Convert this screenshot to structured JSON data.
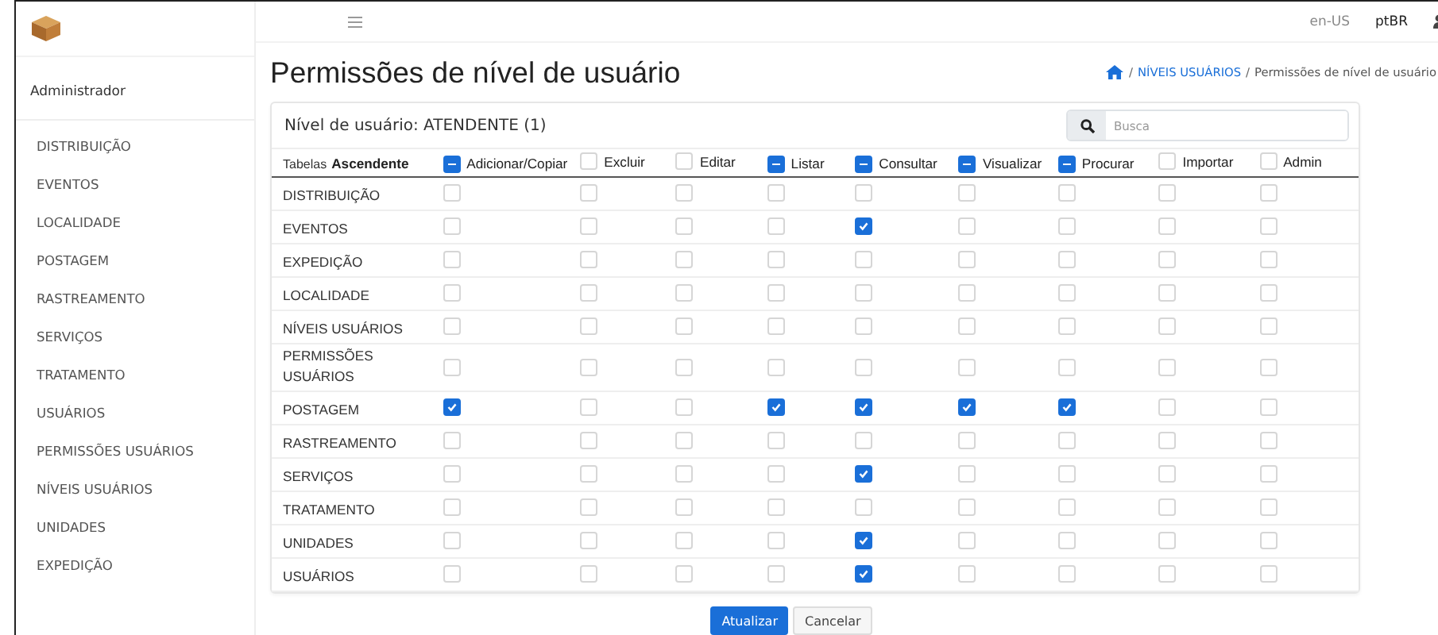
{
  "topbar": {
    "languages": [
      {
        "label": "en-US",
        "selected": false
      },
      {
        "label": "ptBR",
        "selected": true
      }
    ]
  },
  "sidebar": {
    "user": "Administrador",
    "items": [
      {
        "label": "DISTRIBUIÇÃO"
      },
      {
        "label": "EVENTOS"
      },
      {
        "label": "LOCALIDADE"
      },
      {
        "label": "POSTAGEM"
      },
      {
        "label": "RASTREAMENTO"
      },
      {
        "label": "SERVIÇOS"
      },
      {
        "label": "TRATAMENTO"
      },
      {
        "label": "USUÁRIOS"
      },
      {
        "label": "PERMISSÕES USUÁRIOS"
      },
      {
        "label": "NÍVEIS USUÁRIOS"
      },
      {
        "label": "UNIDADES"
      },
      {
        "label": "EXPEDIÇÃO"
      }
    ]
  },
  "page": {
    "title": "Permissões de nível de usuário",
    "breadcrumb": [
      {
        "separator": "/",
        "label": "NÍVEIS USUÁRIOS",
        "kind": "link"
      },
      {
        "separator": "/",
        "label": "Permissões de nível de usuário",
        "kind": "current"
      }
    ]
  },
  "card": {
    "level_label": "Nível de usuário: ATENDENTE (1)",
    "search": {
      "placeholder": "Busca"
    },
    "table": {
      "tables_label": "Tabelas",
      "sort_label": "Ascendente",
      "columns": [
        {
          "label": "Adicionar/Copiar",
          "indeterminate": true
        },
        {
          "label": "Excluir",
          "indeterminate": false
        },
        {
          "label": "Editar",
          "indeterminate": false
        },
        {
          "label": "Listar",
          "indeterminate": true
        },
        {
          "label": "Consultar",
          "indeterminate": true
        },
        {
          "label": "Visualizar",
          "indeterminate": true
        },
        {
          "label": "Procurar",
          "indeterminate": true
        },
        {
          "label": "Importar",
          "indeterminate": false
        },
        {
          "label": "Admin",
          "indeterminate": false
        }
      ],
      "rows": [
        {
          "name": "DISTRIBUIÇÃO",
          "cells": [
            {
              "checked": false
            },
            {
              "checked": false
            },
            {
              "checked": false
            },
            {
              "checked": false
            },
            {
              "checked": false
            },
            {
              "checked": false
            },
            {
              "checked": false
            },
            {
              "checked": false
            },
            {
              "checked": false
            }
          ]
        },
        {
          "name": "EVENTOS",
          "cells": [
            {
              "checked": false
            },
            {
              "checked": false
            },
            {
              "checked": false
            },
            {
              "checked": false
            },
            {
              "checked": true
            },
            {
              "checked": false
            },
            {
              "checked": false
            },
            {
              "checked": false
            },
            {
              "checked": false
            }
          ]
        },
        {
          "name": "EXPEDIÇÃO",
          "cells": [
            {
              "checked": false
            },
            {
              "checked": false
            },
            {
              "checked": false
            },
            {
              "checked": false
            },
            {
              "checked": false
            },
            {
              "checked": false
            },
            {
              "checked": false
            },
            {
              "checked": false
            },
            {
              "checked": false
            }
          ]
        },
        {
          "name": "LOCALIDADE",
          "cells": [
            {
              "checked": false
            },
            {
              "checked": false
            },
            {
              "checked": false
            },
            {
              "checked": false
            },
            {
              "checked": false
            },
            {
              "checked": false
            },
            {
              "checked": false
            },
            {
              "checked": false
            },
            {
              "checked": false
            }
          ]
        },
        {
          "name": "NÍVEIS USUÁRIOS",
          "cells": [
            {
              "checked": false
            },
            {
              "checked": false
            },
            {
              "checked": false
            },
            {
              "checked": false
            },
            {
              "checked": false
            },
            {
              "checked": false
            },
            {
              "checked": false
            },
            {
              "checked": false
            },
            {
              "checked": false
            }
          ]
        },
        {
          "name": "PERMISSÕES USUÁRIOS",
          "cells": [
            {
              "checked": false
            },
            {
              "checked": false
            },
            {
              "checked": false
            },
            {
              "checked": false
            },
            {
              "checked": false
            },
            {
              "checked": false
            },
            {
              "checked": false
            },
            {
              "checked": false
            },
            {
              "checked": false
            }
          ]
        },
        {
          "name": "POSTAGEM",
          "cells": [
            {
              "checked": true
            },
            {
              "checked": false
            },
            {
              "checked": false
            },
            {
              "checked": true
            },
            {
              "checked": true
            },
            {
              "checked": true
            },
            {
              "checked": true
            },
            {
              "checked": false
            },
            {
              "checked": false
            }
          ]
        },
        {
          "name": "RASTREAMENTO",
          "cells": [
            {
              "checked": false
            },
            {
              "checked": false
            },
            {
              "checked": false
            },
            {
              "checked": false
            },
            {
              "checked": false
            },
            {
              "checked": false
            },
            {
              "checked": false
            },
            {
              "checked": false
            },
            {
              "checked": false
            }
          ]
        },
        {
          "name": "SERVIÇOS",
          "cells": [
            {
              "checked": false
            },
            {
              "checked": false
            },
            {
              "checked": false
            },
            {
              "checked": false
            },
            {
              "checked": true
            },
            {
              "checked": false
            },
            {
              "checked": false
            },
            {
              "checked": false
            },
            {
              "checked": false
            }
          ]
        },
        {
          "name": "TRATAMENTO",
          "cells": [
            {
              "checked": false
            },
            {
              "checked": false
            },
            {
              "checked": false
            },
            {
              "checked": false
            },
            {
              "checked": false
            },
            {
              "checked": false
            },
            {
              "checked": false
            },
            {
              "checked": false
            },
            {
              "checked": false
            }
          ]
        },
        {
          "name": "UNIDADES",
          "cells": [
            {
              "checked": false
            },
            {
              "checked": false
            },
            {
              "checked": false
            },
            {
              "checked": false
            },
            {
              "checked": true
            },
            {
              "checked": false
            },
            {
              "checked": false
            },
            {
              "checked": false
            },
            {
              "checked": false
            }
          ]
        },
        {
          "name": "USUÁRIOS",
          "cells": [
            {
              "checked": false
            },
            {
              "checked": false
            },
            {
              "checked": false
            },
            {
              "checked": false
            },
            {
              "checked": true
            },
            {
              "checked": false
            },
            {
              "checked": false
            },
            {
              "checked": false
            },
            {
              "checked": false
            }
          ]
        }
      ]
    }
  },
  "buttons": [
    {
      "label": "Atualizar",
      "kind": "primary"
    },
    {
      "label": "Cancelar",
      "kind": "secondary"
    }
  ]
}
